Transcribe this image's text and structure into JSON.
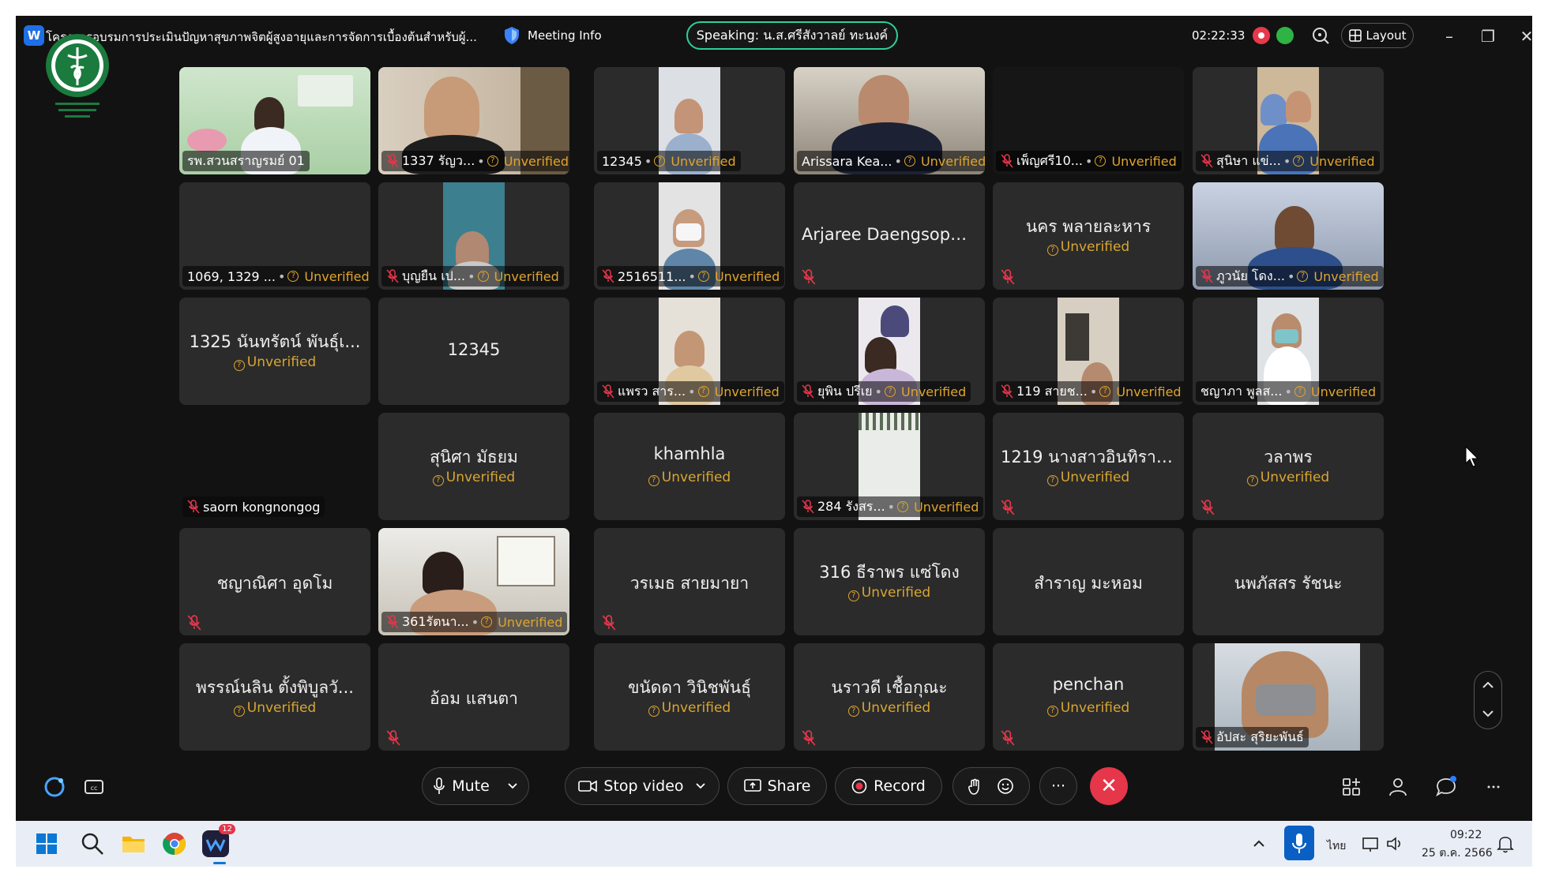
{
  "titlebar": {
    "title": "โครงการอบรมการประเมินปัญหาสุขภาพจิตผู้สูงอายุและการจัดการเบื้องต้นสำหรับผู้...",
    "meeting_info": "Meeting Info",
    "speaking": "Speaking: น.ส.ศรีสังวาลย์ ทะนงค์",
    "timer": "02:22:33",
    "layout": "Layout"
  },
  "unverified_label": "Unverified",
  "tiles": [
    {
      "name": "รพ.สวนสราญรมย์ 01"
    },
    {
      "name": "1337 รัญว..."
    },
    {
      "name": "12345"
    },
    {
      "name": "Arissara Kea..."
    },
    {
      "name": "เพ็ญศรี10..."
    },
    {
      "name": "สุนิษา แข่..."
    },
    {
      "name": "1069, 1329 ..."
    },
    {
      "name": "บุญยืน เป..."
    },
    {
      "name": "2516511..."
    },
    {
      "name": "Arjaree Daengsophon"
    },
    {
      "name": "นคร พลายละหาร"
    },
    {
      "name": "ภูวนัย โดง..."
    },
    {
      "name": "1325 นันทรัตน์ พันธุ์เ..."
    },
    {
      "name": "12345"
    },
    {
      "name": "แพรว สาร..."
    },
    {
      "name": "ยุพิน ปรีเย"
    },
    {
      "name": "119 สายช..."
    },
    {
      "name": "ชญาภา พูลส..."
    },
    {
      "name": "saorn kongnongog"
    },
    {
      "name": "สุนิศา มัธยม"
    },
    {
      "name": "khamhla"
    },
    {
      "name": "284 รังสร..."
    },
    {
      "name": "1219 นางสาวอินทิรา ..."
    },
    {
      "name": "วลาพร"
    },
    {
      "name": "ชญาณิศา อุดโม"
    },
    {
      "name": "361รัตนา..."
    },
    {
      "name": "วรเมธ สายมายา"
    },
    {
      "name": "316 ธีราพร แซ่โดง"
    },
    {
      "name": "สำราญ มะหอม"
    },
    {
      "name": "นพภัสสร รัชนะ"
    },
    {
      "name": "พรรณ์นลิน ตั้งพิบูลวั..."
    },
    {
      "name": "อ้อม แสนตา"
    },
    {
      "name": "ขนัดดา วินิชพันธุ์"
    },
    {
      "name": "นราวดี เชื้อกุณะ"
    },
    {
      "name": "penchan"
    },
    {
      "name": "อัปสะ สุริยะพันธ์"
    }
  ],
  "controls": {
    "mute": "Mute",
    "stop_video": "Stop video",
    "share": "Share",
    "record": "Record"
  },
  "taskbar": {
    "lang": "ไทย",
    "time": "09:22",
    "date": "25 ต.ค. 2566",
    "badge": "12"
  },
  "colors": {
    "background": "#121212",
    "tile": "#2b2b2b",
    "unverified": "#e0a42c",
    "speaking_border": "#2bd19a",
    "leave": "#e5364a"
  }
}
